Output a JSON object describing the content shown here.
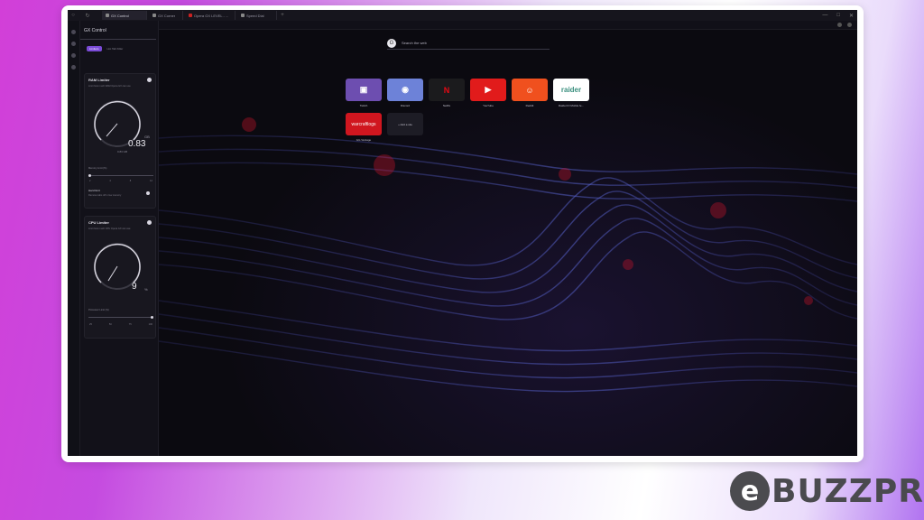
{
  "tabs": [
    {
      "label": "GX Control",
      "active": true
    },
    {
      "label": "GX Corner",
      "active": false
    },
    {
      "label": "Opera GX LEVEL - ...",
      "active": false
    },
    {
      "label": "Speed Dial",
      "active": false
    }
  ],
  "sidebar": {
    "title": "GX Control",
    "tab_active": "Limiters",
    "tab_other": "Hot Tab Killer",
    "ram": {
      "title": "RAM Limiter",
      "desc": "Limit how much RAM Opera GX can use",
      "value": "0.83",
      "unit": "GB",
      "small": "0.83 GB",
      "slider_label": "Memory Limit (%)",
      "slider_value_fraction": 0.0,
      "ticks": [
        "2",
        "4",
        "8",
        "12"
      ],
      "hard_limit_title": "Hard limit",
      "hard_limit_desc": "Remove tabs off in low memory"
    },
    "cpu": {
      "title": "CPU Limiter",
      "desc": "Limit how much CPU Opera GX can use",
      "value": "9",
      "unit": "%",
      "slider_label": "Processor Limit (%)",
      "slider_value_fraction": 1.0,
      "ticks": [
        "25",
        "50",
        "75",
        "100"
      ]
    }
  },
  "search": {
    "placeholder": "Search the web"
  },
  "speed_dial": [
    {
      "label": "Twitch",
      "icon": "twitch-icon",
      "color": "#6d4eb0",
      "glyph": "▣"
    },
    {
      "label": "Discord",
      "icon": "discord-icon",
      "color": "#6d82d8",
      "glyph": "◉"
    },
    {
      "label": "Netflix",
      "icon": "netflix-icon",
      "color": "#1b1b1d",
      "glyph": "N"
    },
    {
      "label": "YouTube",
      "icon": "youtube-icon",
      "color": "#e11b1b",
      "glyph": "▶"
    },
    {
      "label": "Reddit",
      "icon": "reddit-icon",
      "color": "#f0501e",
      "glyph": "☺"
    },
    {
      "label": "raider.io",
      "display": "Raider.IO Mobile fe...",
      "icon": "raider-logo",
      "color": "#ffffff",
      "glyph": "raider"
    },
    {
      "label": "WoW Vanity",
      "display": "GG Vantage",
      "icon": "warcraftlogs-logo",
      "color": "#d0161f",
      "glyph": "warcraftlogs"
    }
  ],
  "add_site": "+ Add a site",
  "watermark": {
    "letter": "e",
    "text": "BUZZPRO"
  }
}
